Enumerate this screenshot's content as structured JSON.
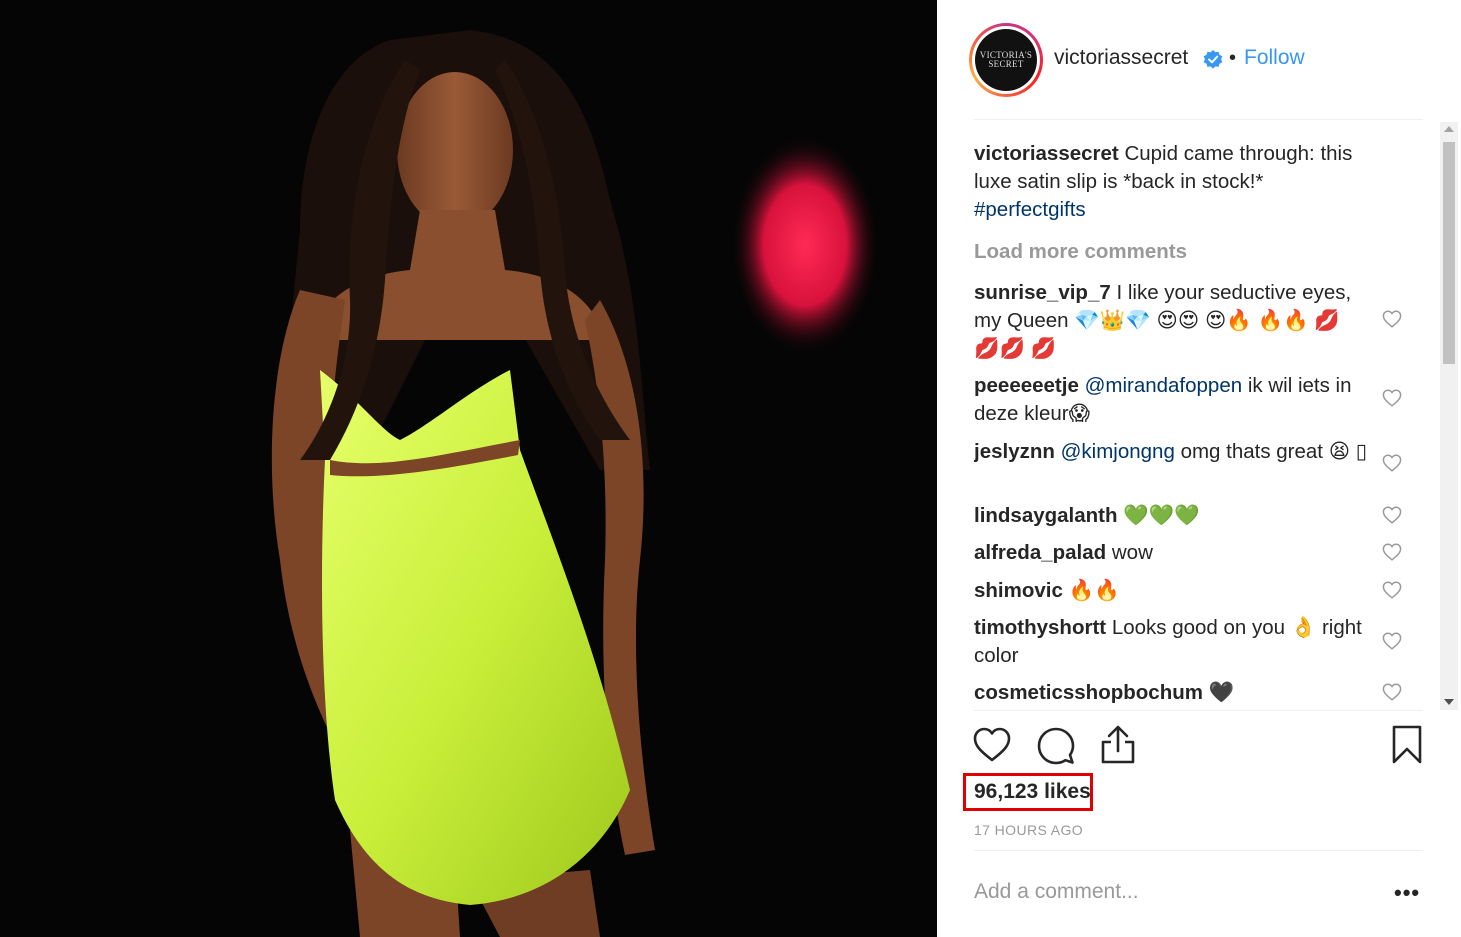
{
  "post": {
    "username": "victoriassecret",
    "follow_label": "Follow",
    "separator": "•",
    "avatar_text_1": "VICTORIA'S",
    "avatar_text_2": "SECRET",
    "caption_user": "victoriassecret",
    "caption_text": "Cupid came through: this luxe satin slip is *back in stock!*",
    "caption_hashtag": "#perfectgifts",
    "load_more": "Load more comments"
  },
  "comments": [
    {
      "user": "sunrise_vip_7",
      "text": "I like your seductive eyes, my Queen 💎👑💎 😍😍 😍🔥 🔥🔥 💋 💋💋 💋"
    },
    {
      "user": "peeeeeetje",
      "mention": "@mirandafoppen",
      "text": "ik wil iets in deze kleur😱"
    },
    {
      "user": "jeslyznn",
      "mention": "@kimjongng",
      "text": "omg thats great 😫 ▯"
    },
    {
      "user": "lindsaygalanth",
      "text": "💚💚💚"
    },
    {
      "user": "alfreda_palad",
      "text": "wow"
    },
    {
      "user": "shimovic",
      "text": "🔥🔥"
    },
    {
      "user": "timothyshortt",
      "text": "Looks good on you 👌 right color"
    },
    {
      "user": "cosmeticsshopbochum",
      "text": "🖤"
    }
  ],
  "stats": {
    "likes": "96,123 likes",
    "time": "17 HOURS AGO"
  },
  "composer": {
    "placeholder": "Add a comment...",
    "more": "•••"
  },
  "icons": {
    "like": "heart-icon",
    "comment": "comment-bubble-icon",
    "share": "share-icon",
    "save": "bookmark-icon",
    "verified": "verified-badge-icon"
  },
  "colors": {
    "link_blue": "#3897f0",
    "hashtag": "#003569",
    "muted": "#999999",
    "highlight": "#e00000"
  }
}
